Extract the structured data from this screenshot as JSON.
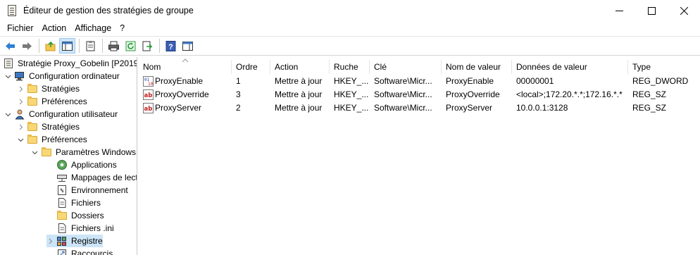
{
  "window": {
    "title": "Éditeur de gestion des stratégies de groupe",
    "controls": [
      "minimize-icon",
      "maximize-icon",
      "close-icon"
    ]
  },
  "menu": [
    "Fichier",
    "Action",
    "Affichage",
    "?"
  ],
  "toolbar": {
    "icons": [
      "back-arrow-icon",
      "forward-arrow-icon",
      "up-folder-icon",
      "show-hide-console-tree-icon",
      "properties-icon",
      "print-icon",
      "refresh-icon",
      "export-list-icon",
      "help-icon",
      "show-action-pane-icon"
    ],
    "active_button": "show-hide-console-tree-icon"
  },
  "tree": {
    "items": [
      {
        "label": "Stratégie Proxy_Gobelin [P2019.",
        "level": 0,
        "expander": "none",
        "icon": "policy-document-icon"
      },
      {
        "label": "Configuration ordinateur",
        "level": 1,
        "expander": "expanded",
        "icon": "computer-config-icon"
      },
      {
        "label": "Stratégies",
        "level": 2,
        "expander": "collapsed",
        "icon": "folder-icon"
      },
      {
        "label": "Préférences",
        "level": 2,
        "expander": "collapsed",
        "icon": "folder-icon"
      },
      {
        "label": "Configuration utilisateur",
        "level": 1,
        "expander": "expanded",
        "icon": "user-config-icon"
      },
      {
        "label": "Stratégies",
        "level": 2,
        "expander": "collapsed",
        "icon": "folder-icon"
      },
      {
        "label": "Préférences",
        "level": 2,
        "expander": "expanded",
        "icon": "folder-icon"
      },
      {
        "label": "Paramètres Windows",
        "level": 3,
        "expander": "expanded",
        "icon": "folder-open-icon"
      },
      {
        "label": "Applications",
        "level": 4,
        "expander": "none",
        "icon": "applications-icon"
      },
      {
        "label": "Mappages de lect",
        "level": 4,
        "expander": "none",
        "icon": "drive-maps-icon"
      },
      {
        "label": "Environnement",
        "level": 4,
        "expander": "none",
        "icon": "environment-icon"
      },
      {
        "label": "Fichiers",
        "level": 4,
        "expander": "none",
        "icon": "files-icon"
      },
      {
        "label": "Dossiers",
        "level": 4,
        "expander": "none",
        "icon": "folders-icon"
      },
      {
        "label": "Fichiers .ini",
        "level": 4,
        "expander": "none",
        "icon": "ini-files-icon"
      },
      {
        "label": "Registre",
        "level": 4,
        "expander": "collapsed",
        "icon": "registry-icon",
        "selected": true
      },
      {
        "label": "Raccourcis",
        "level": 4,
        "expander": "none",
        "icon": "shortcuts-icon"
      }
    ]
  },
  "list": {
    "columns": [
      "Nom",
      "Ordre",
      "Action",
      "Ruche",
      "Clé",
      "Nom de valeur",
      "Données de valeur",
      "Type"
    ],
    "rows": [
      {
        "icon": "reg-binary-icon",
        "cells": [
          "ProxyEnable",
          "1",
          "Mettre à jour",
          "HKEY_...",
          "Software\\Micr...",
          "ProxyEnable",
          "00000001",
          "REG_DWORD"
        ]
      },
      {
        "icon": "reg-string-icon",
        "cells": [
          "ProxyOverride",
          "3",
          "Mettre à jour",
          "HKEY_...",
          "Software\\Micr...",
          "ProxyOverride",
          "<local>;172.20.*.*;172.16.*.*",
          "REG_SZ"
        ]
      },
      {
        "icon": "reg-string-icon",
        "cells": [
          "ProxyServer",
          "2",
          "Mettre à jour",
          "HKEY_...",
          "Software\\Micr...",
          "ProxyServer",
          "10.0.0.1:3128",
          "REG_SZ"
        ]
      }
    ]
  },
  "colors": {
    "selection": "#cce4f7",
    "selection_border": "#99c9ef",
    "folder": "#f8d775"
  }
}
